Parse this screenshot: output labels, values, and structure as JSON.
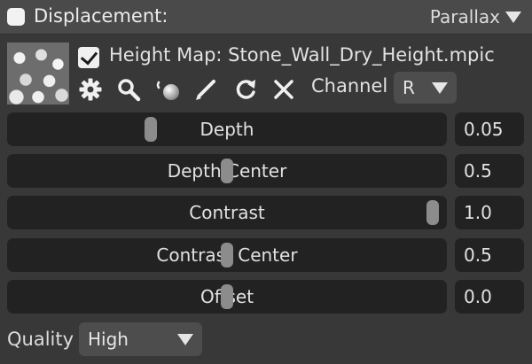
{
  "header": {
    "title": "Displacement:",
    "mode": "Parallax"
  },
  "height_map": {
    "enabled": true,
    "label": "Height Map: Stone_Wall_Dry_Height.mpic"
  },
  "toolbar": {
    "icons": [
      "gear-icon",
      "search-icon",
      "pick-material-icon",
      "paint-brush-icon",
      "refresh-icon",
      "close-icon"
    ]
  },
  "channel": {
    "label": "Channel",
    "value": "R"
  },
  "sliders": [
    {
      "label": "Depth",
      "value": "0.05",
      "fraction": 0.32
    },
    {
      "label": "Depth Center",
      "value": "0.5",
      "fraction": 0.5
    },
    {
      "label": "Contrast",
      "value": "1.0",
      "fraction": 0.985
    },
    {
      "label": "Contrast Center",
      "value": "0.5",
      "fraction": 0.5
    },
    {
      "label": "Offset",
      "value": "0.0",
      "fraction": 0.5
    }
  ],
  "quality": {
    "label": "Quality",
    "value": "High"
  }
}
